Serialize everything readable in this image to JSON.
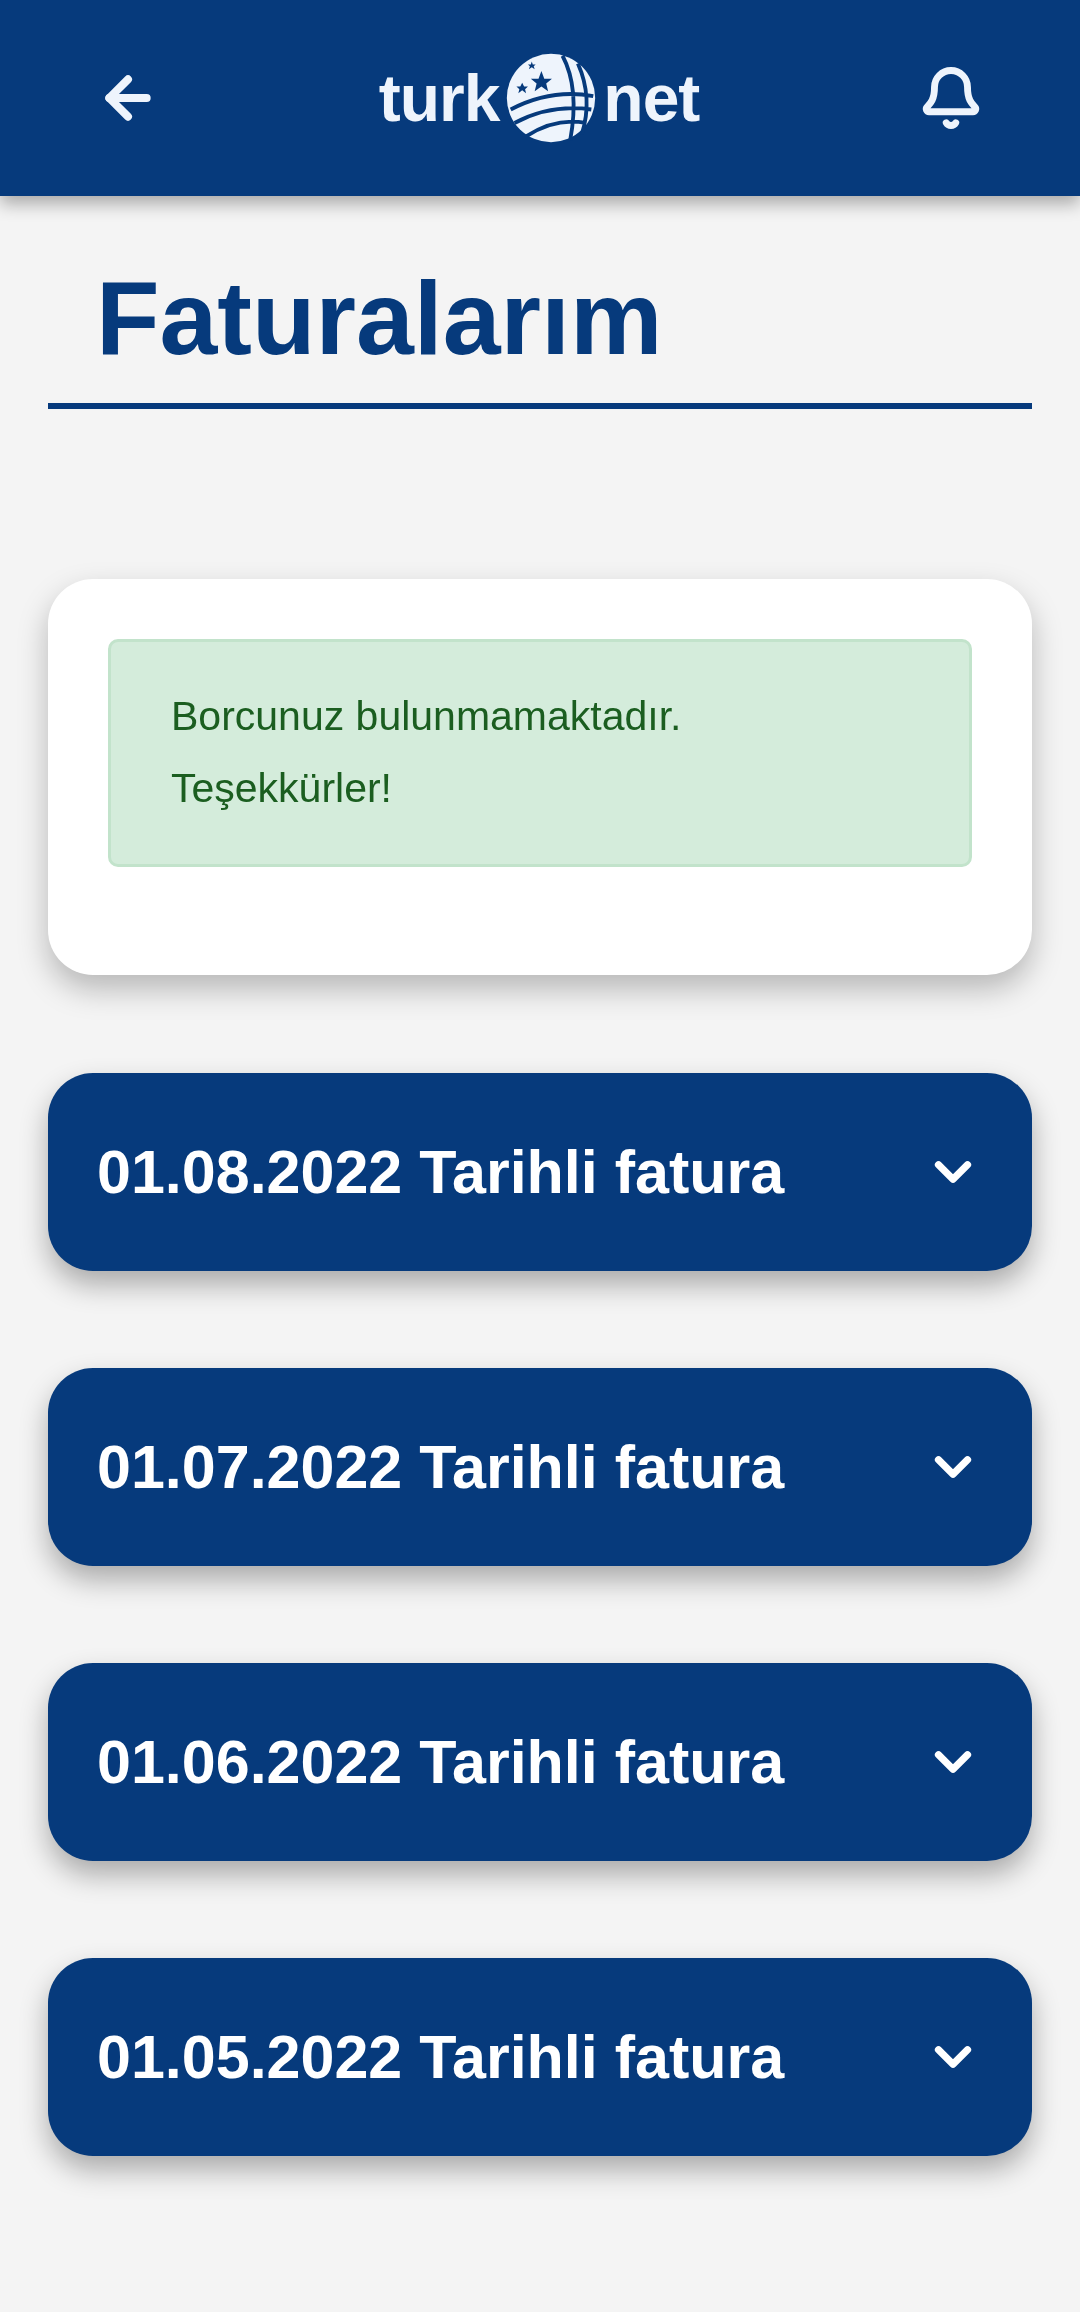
{
  "header": {
    "logo": {
      "left": "turk",
      "right": "net"
    }
  },
  "title": "Faturalarım",
  "notice": {
    "lines": [
      "Borcunuz bulunmamaktadır.",
      "Teşekkürler!"
    ]
  },
  "invoices": [
    {
      "label": "01.08.2022 Tarihli fatura",
      "expanded": false
    },
    {
      "label": "01.07.2022 Tarihli fatura",
      "expanded": false
    },
    {
      "label": "01.06.2022 Tarihli fatura",
      "expanded": false
    },
    {
      "label": "01.05.2022 Tarihli fatura",
      "expanded": false
    }
  ]
}
